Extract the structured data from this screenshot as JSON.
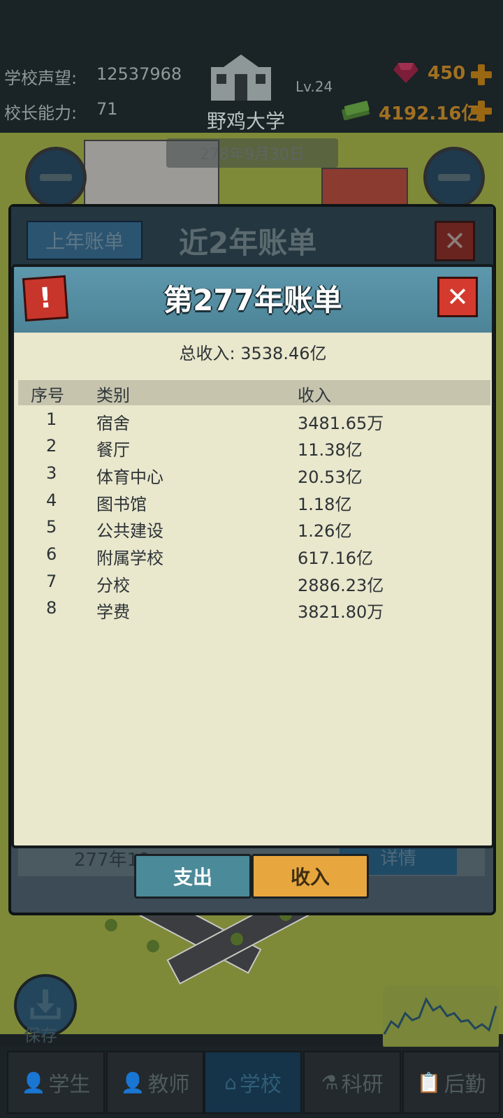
{
  "hud": {
    "reputation_label": "学校声望:",
    "reputation_value": "12537968",
    "ability_label": "校长能力:",
    "ability_value": "71",
    "level": "Lv.24",
    "school_name": "野鸡大学",
    "gems": "450",
    "money": "4192.16亿",
    "date": "278年9月30日"
  },
  "outer_panel": {
    "prev_button": "上年账单",
    "title": "近2年账单",
    "footer_text": "277年10",
    "detail_button": "详情"
  },
  "dialog": {
    "title": "第277年账单",
    "total_label": "总收入:",
    "total_value": "3538.46亿",
    "headers": {
      "no": "序号",
      "category": "类别",
      "income": "收入"
    },
    "rows": [
      {
        "no": "1",
        "category": "宿舍",
        "income": "3481.65万"
      },
      {
        "no": "2",
        "category": "餐厅",
        "income": "11.38亿"
      },
      {
        "no": "3",
        "category": "体育中心",
        "income": "20.53亿"
      },
      {
        "no": "4",
        "category": "图书馆",
        "income": "1.18亿"
      },
      {
        "no": "5",
        "category": "公共建设",
        "income": "1.26亿"
      },
      {
        "no": "6",
        "category": "附属学校",
        "income": "617.16亿"
      },
      {
        "no": "7",
        "category": "分校",
        "income": "2886.23亿"
      },
      {
        "no": "8",
        "category": "学费",
        "income": "3821.80万"
      }
    ],
    "tab_expense": "支出",
    "tab_income": "收入"
  },
  "save_label": "保存",
  "nav": [
    {
      "label": "学生",
      "icon": "student-icon"
    },
    {
      "label": "教师",
      "icon": "teacher-icon"
    },
    {
      "label": "学校",
      "icon": "school-icon",
      "active": true
    },
    {
      "label": "科研",
      "icon": "flask-icon"
    },
    {
      "label": "后勤",
      "icon": "clipboard-icon"
    }
  ],
  "colors": {
    "dialog_bg": "#e9e7cc",
    "header_blue": "#4c8397",
    "income_tab": "#e8a73e",
    "expense_tab": "#4b8a98",
    "gold": "#a17022"
  }
}
